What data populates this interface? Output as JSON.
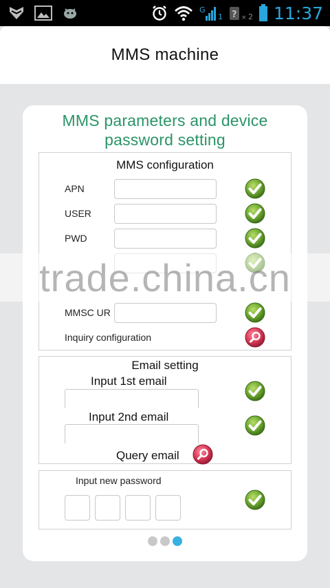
{
  "status_bar": {
    "time": "11:37",
    "sim1_label": "1",
    "sim2_label": "2",
    "icons": [
      "shield-icon",
      "image-icon",
      "android-icon",
      "alarm-icon",
      "wifi-icon",
      "signal-icon",
      "signal-no-sim-icon",
      "battery-icon"
    ]
  },
  "app": {
    "title": "MMS machine"
  },
  "card": {
    "title_line1": "MMS parameters and device",
    "title_line2": "password setting"
  },
  "mms": {
    "heading": "MMS configuration",
    "fields": [
      {
        "label": "APN",
        "value": ""
      },
      {
        "label": "USER",
        "value": ""
      },
      {
        "label": "PWD",
        "value": ""
      },
      {
        "label": "",
        "value": ""
      },
      {
        "label": "MMSC  UR",
        "value": ""
      }
    ],
    "inquiry_label": "Inquiry configuration"
  },
  "email": {
    "heading": "Email setting",
    "first_label": "Input 1st email",
    "first_value": "",
    "second_label": "Input 2nd email",
    "second_value": "",
    "query_label": "Query email"
  },
  "password": {
    "heading": "Input new password",
    "digits": [
      "",
      "",
      "",
      ""
    ]
  },
  "pager": {
    "pages": 3,
    "active_index": 2
  },
  "watermark": {
    "text": "trade.china.cn"
  },
  "colors": {
    "accent_green": "#2a9467",
    "confirm_green": "#6aa33a",
    "query_red": "#d83c57",
    "status_blue": "#29a6dc",
    "pager_active": "#38b0e0"
  }
}
